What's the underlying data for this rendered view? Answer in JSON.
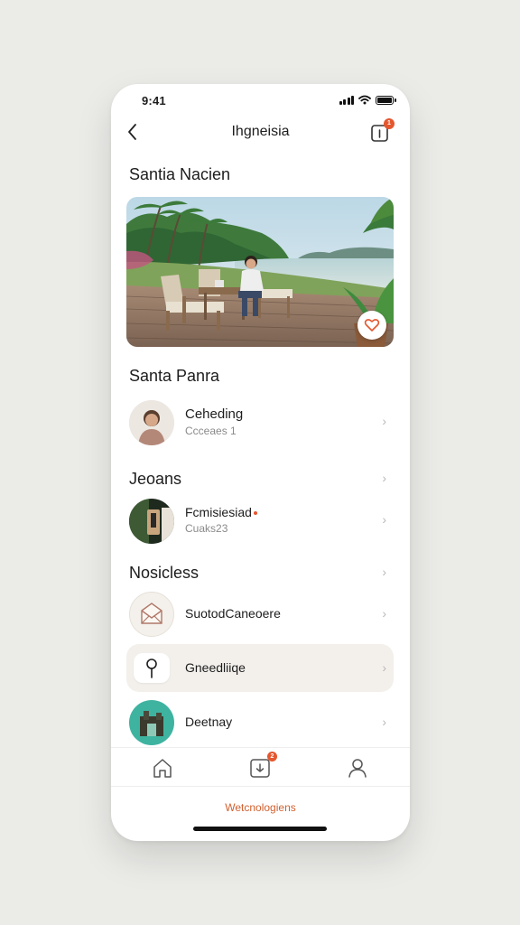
{
  "status": {
    "time": "9:41"
  },
  "nav": {
    "title": "Ihgneisia",
    "badge": "1"
  },
  "featured": {
    "title": "Santia Nacien"
  },
  "sections": [
    {
      "title": "Santa Panra"
    },
    {
      "title": "Jeoans"
    },
    {
      "title": "Nosicless"
    }
  ],
  "rows": [
    {
      "title": "Ceheding",
      "subtitle": "Ccceaes  1"
    },
    {
      "title": "Fcmisiesiad",
      "subtitle": "Cuaks23"
    },
    {
      "title": "SuotodCaneoere",
      "subtitle": ""
    },
    {
      "title": "Gneedliiqe",
      "subtitle": ""
    },
    {
      "title": "Deetnay",
      "subtitle": ""
    }
  ],
  "tabbar": {
    "badge": "2"
  },
  "footer": {
    "link": "Wetcnologiens"
  },
  "colors": {
    "accent": "#e4572e",
    "highlight_row": "#f3f0ec",
    "footer_link": "#d0602f"
  },
  "icons": [
    "back-chevron-icon",
    "share-icon",
    "heart-icon",
    "home-icon",
    "inbox-icon",
    "profile-icon",
    "pin-icon",
    "envelope-icon"
  ]
}
